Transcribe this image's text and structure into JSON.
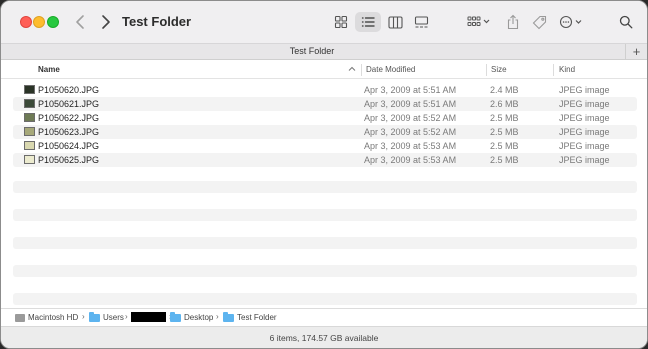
{
  "window": {
    "title": "Test Folder",
    "tab_title": "Test Folder",
    "tab_add": "+"
  },
  "columns": {
    "name": "Name",
    "date_modified": "Date Modified",
    "size": "Size",
    "kind": "Kind"
  },
  "files": [
    {
      "name": "P1050620.JPG",
      "date": "Apr 3, 2009 at 5:51 AM",
      "size": "2.4 MB",
      "kind": "JPEG image",
      "thumb_color": "#2a3326"
    },
    {
      "name": "P1050621.JPG",
      "date": "Apr 3, 2009 at 5:51 AM",
      "size": "2.6 MB",
      "kind": "JPEG image",
      "thumb_color": "#3b4a38"
    },
    {
      "name": "P1050622.JPG",
      "date": "Apr 3, 2009 at 5:52 AM",
      "size": "2.5 MB",
      "kind": "JPEG image",
      "thumb_color": "#6e7a55"
    },
    {
      "name": "P1050623.JPG",
      "date": "Apr 3, 2009 at 5:52 AM",
      "size": "2.5 MB",
      "kind": "JPEG image",
      "thumb_color": "#a6a879"
    },
    {
      "name": "P1050624.JPG",
      "date": "Apr 3, 2009 at 5:53 AM",
      "size": "2.5 MB",
      "kind": "JPEG image",
      "thumb_color": "#d9d8b0"
    },
    {
      "name": "P1050625.JPG",
      "date": "Apr 3, 2009 at 5:53 AM",
      "size": "2.5 MB",
      "kind": "JPEG image",
      "thumb_color": "#ecebcf"
    }
  ],
  "path": {
    "disk": "Macintosh HD",
    "users": "Users",
    "desktop": "Desktop",
    "folder": "Test Folder"
  },
  "status": {
    "text": "6 items, 174.57 GB available"
  },
  "colors": {
    "close": "#ff5f57",
    "minimize": "#febc2e",
    "zoom": "#28c840",
    "folder": "#5db4ef"
  }
}
